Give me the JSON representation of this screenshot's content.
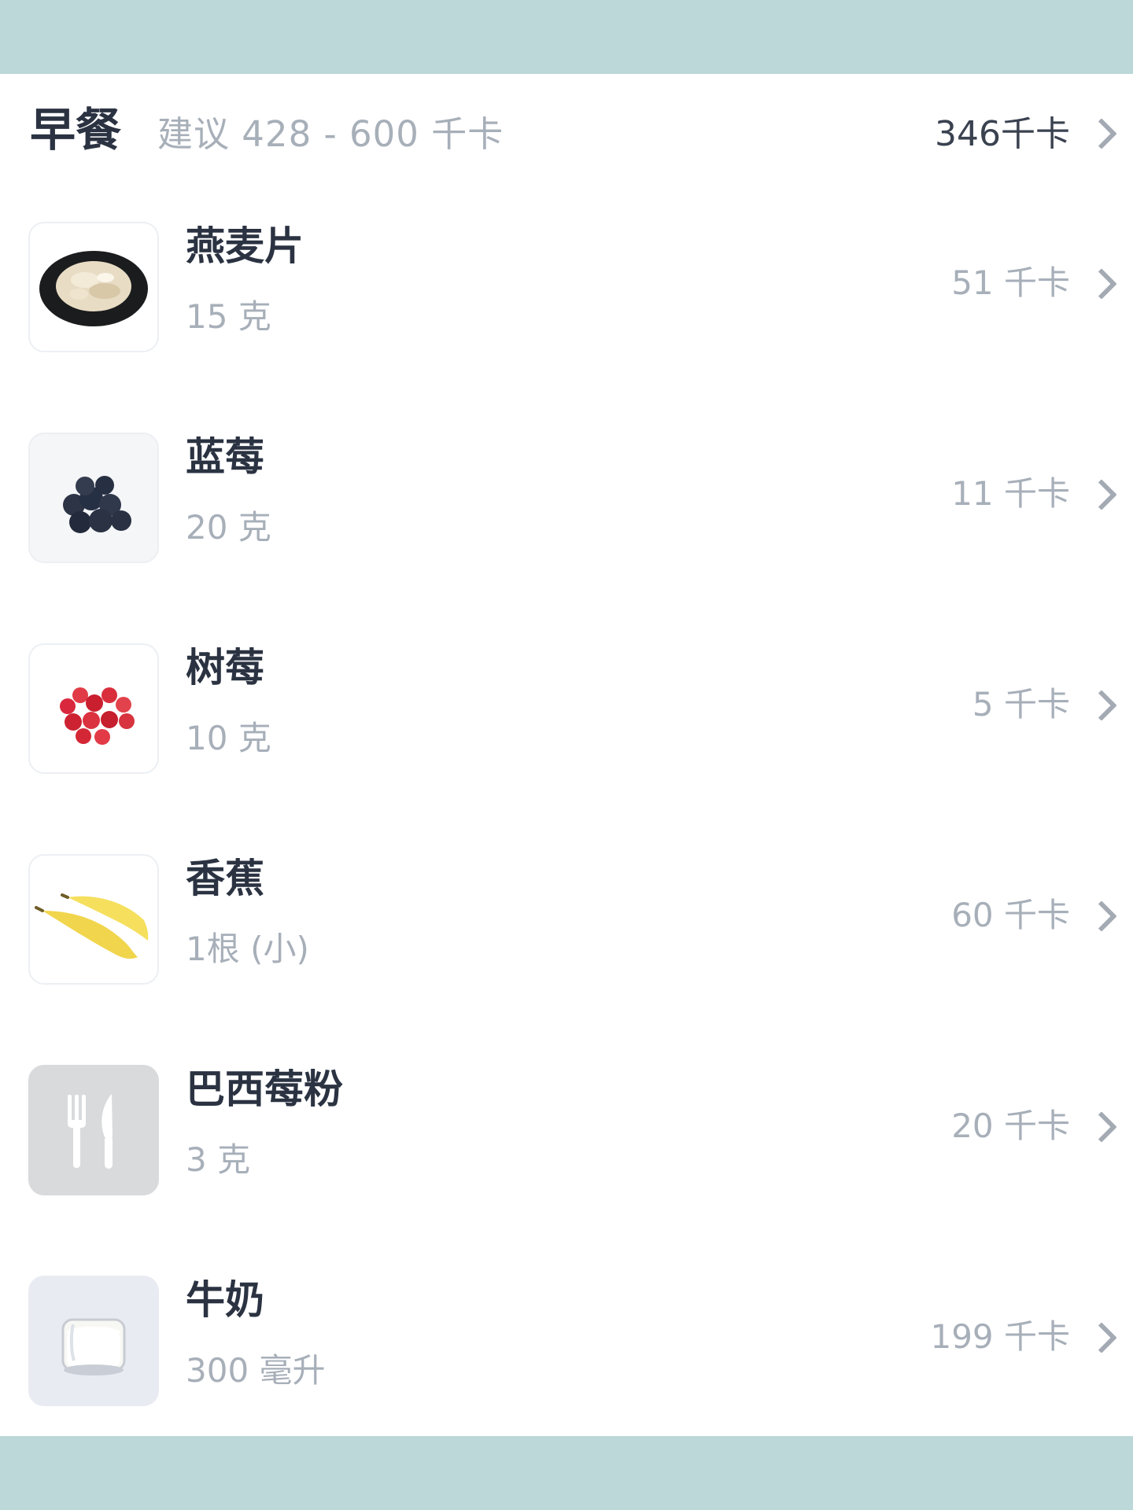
{
  "colors": {
    "background": "#bcd8d9",
    "card": "#ffffff",
    "title_text": "#2b3342",
    "muted_text": "#a7afb9",
    "chevron": "#a4aab3"
  },
  "meal": {
    "title": "早餐",
    "hint": "建议 428 - 600 千卡",
    "total": "346千卡",
    "chevron_icon": "chevron-right-icon"
  },
  "foods": [
    {
      "name": "燕麦片",
      "amount": "15 克",
      "kcal": "51 千卡",
      "icon": "oatmeal-icon"
    },
    {
      "name": "蓝莓",
      "amount": "20 克",
      "kcal": "11 千卡",
      "icon": "blueberry-icon"
    },
    {
      "name": "树莓",
      "amount": "10 克",
      "kcal": "5 千卡",
      "icon": "raspberry-icon"
    },
    {
      "name": "香蕉",
      "amount": "1根 (小)",
      "kcal": "60 千卡",
      "icon": "banana-icon"
    },
    {
      "name": "巴西莓粉",
      "amount": "3 克",
      "kcal": "20 千卡",
      "icon": "utensils-icon"
    },
    {
      "name": "牛奶",
      "amount": "300 毫升",
      "kcal": "199 千卡",
      "icon": "milk-glass-icon"
    }
  ]
}
